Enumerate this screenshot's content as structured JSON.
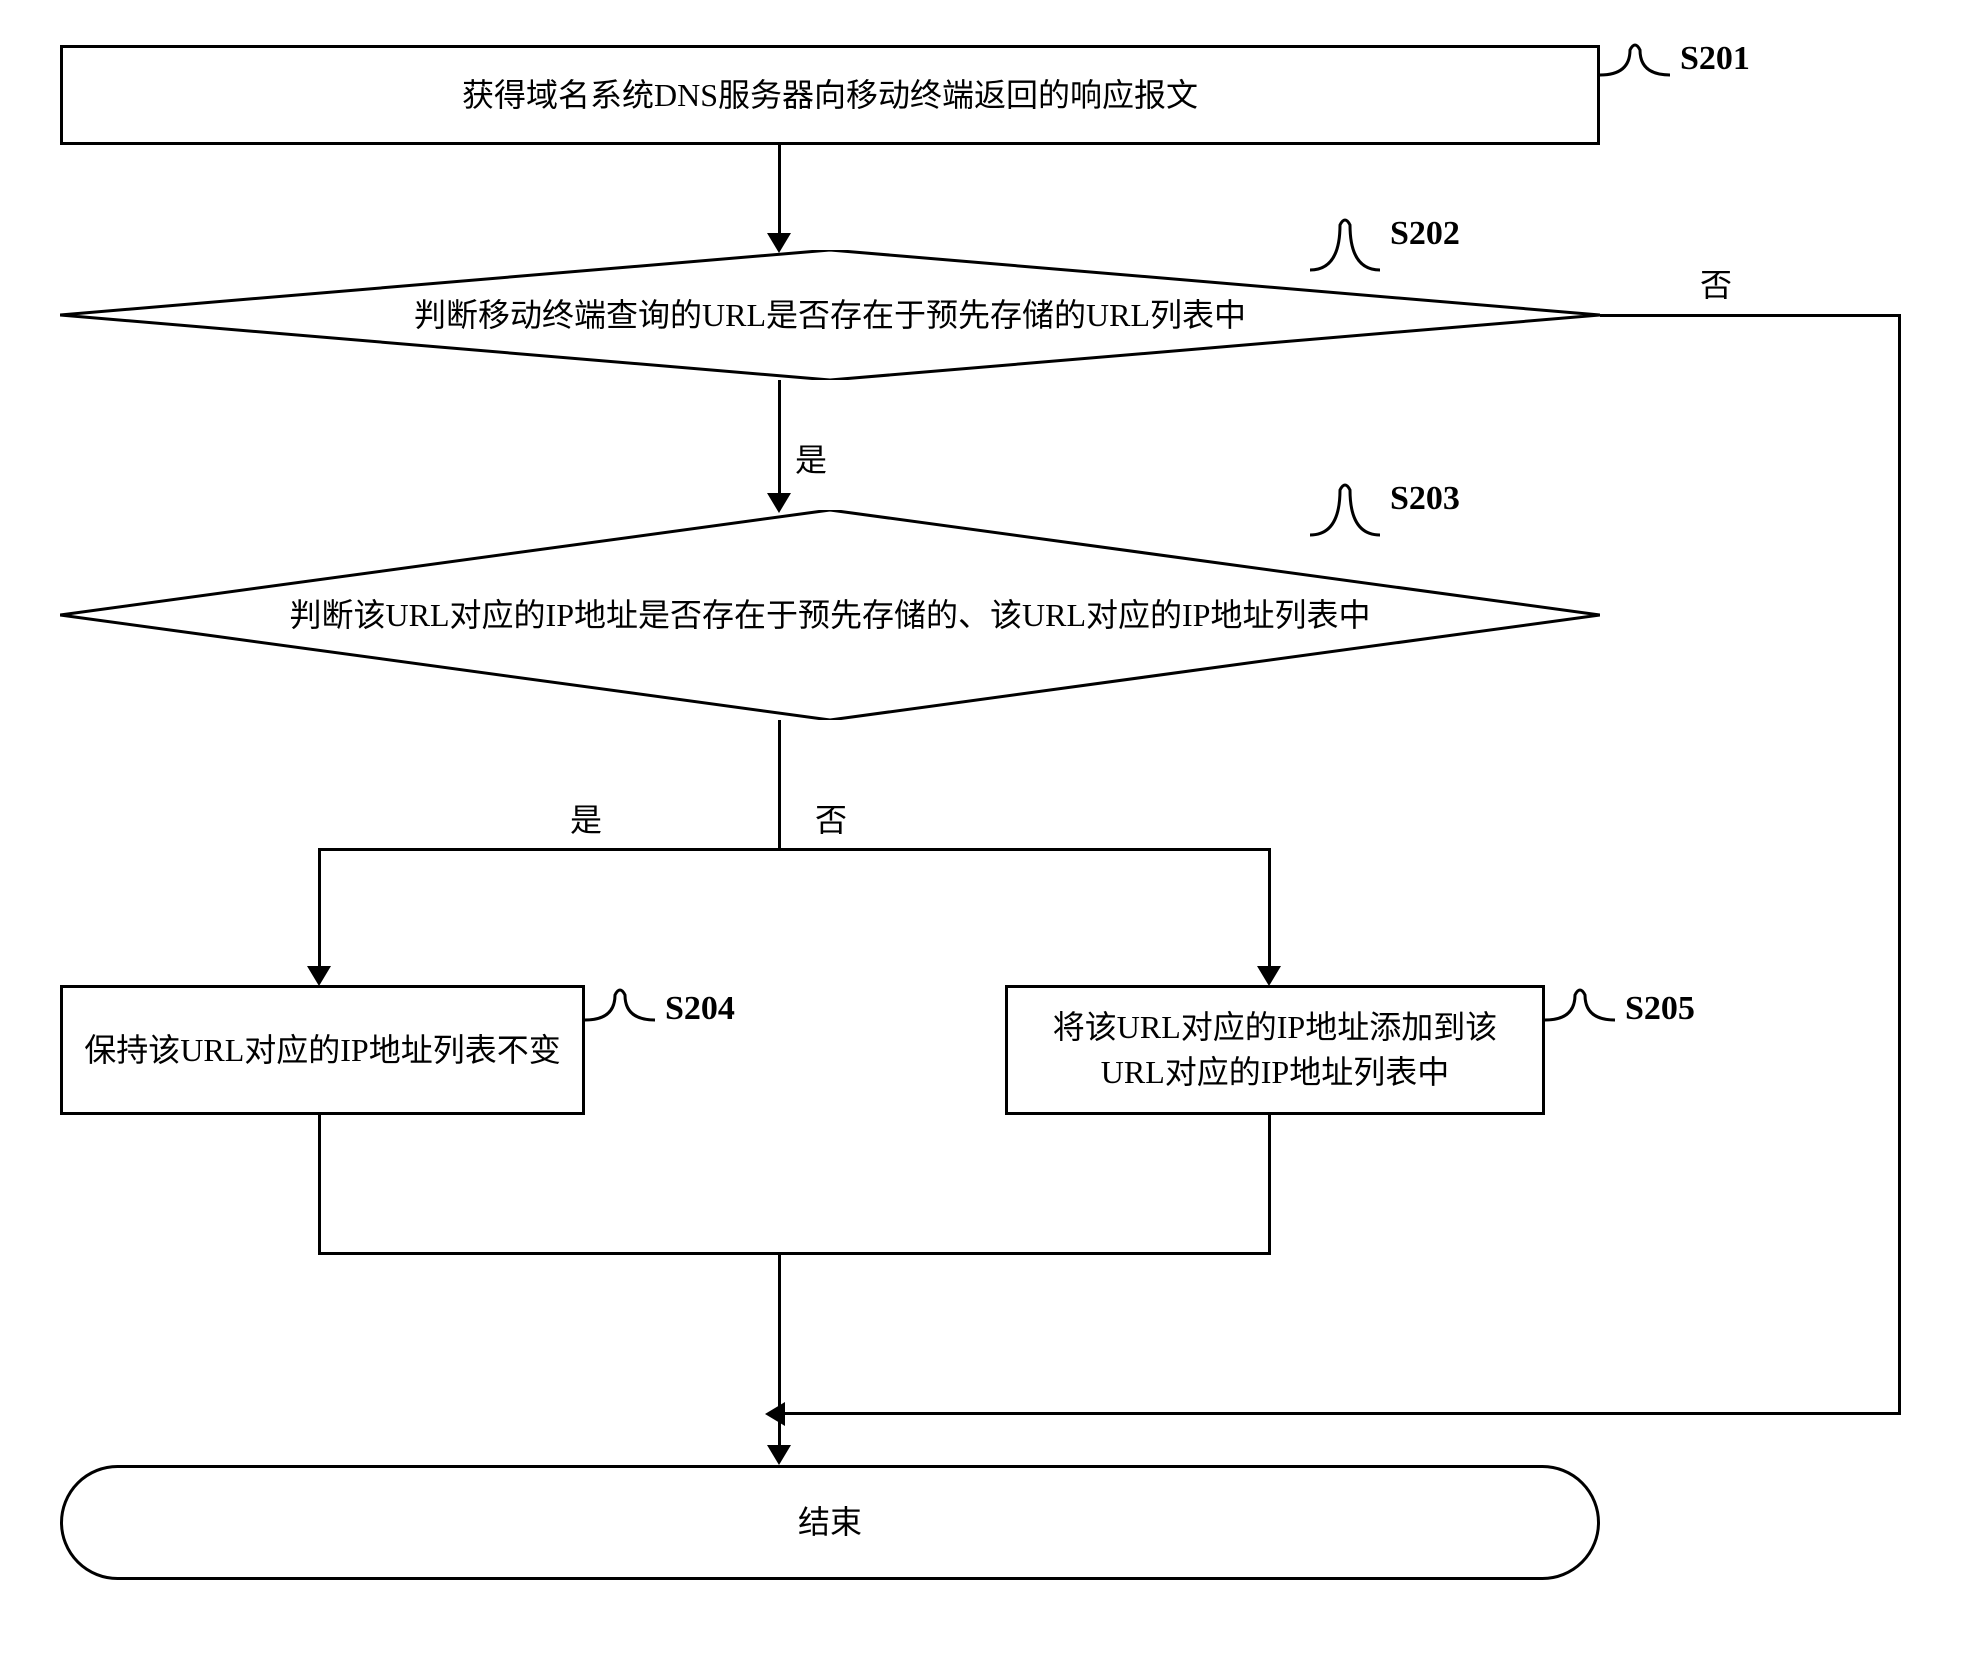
{
  "nodes": {
    "s201": {
      "label": "S201",
      "text": "获得域名系统DNS服务器向移动终端返回的响应报文"
    },
    "s202": {
      "label": "S202",
      "text": "判断移动终端查询的URL是否存在于预先存储的URL列表中"
    },
    "s203": {
      "label": "S203",
      "text": "判断该URL对应的IP地址是否存在于预先存储的、该URL对应的IP地址列表中"
    },
    "s204": {
      "label": "S204",
      "text": "保持该URL对应的IP地址列表不变"
    },
    "s205": {
      "label": "S205",
      "text": "将该URL对应的IP地址添加到该URL对应的IP地址列表中"
    },
    "end": {
      "text": "结束"
    }
  },
  "edges": {
    "yes": "是",
    "no": "否"
  }
}
